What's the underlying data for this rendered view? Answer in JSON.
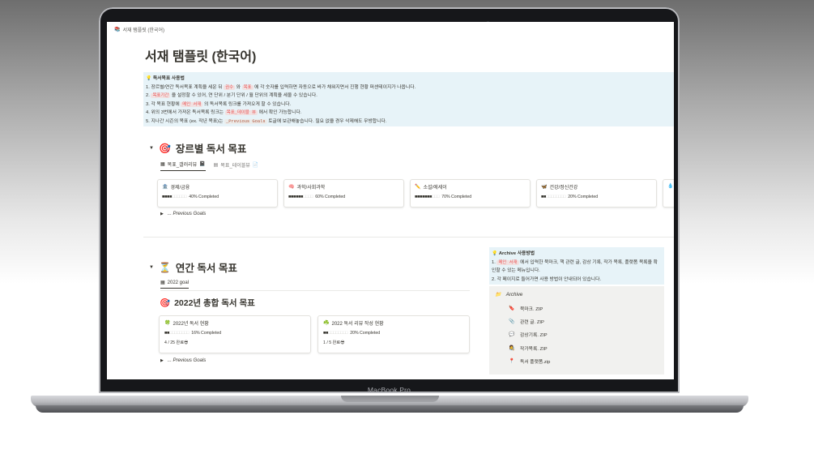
{
  "device": {
    "brand_label": "MacBook Pro"
  },
  "page": {
    "breadcrumb": "서재 탬플릿 (한국어)",
    "title": "서재 탬플릿 (한국어)"
  },
  "goal_callout": {
    "icon": "lightbulb-icon",
    "heading": "독서목표 사용법",
    "line1_a": "1. 장르별/연간 독서목표 계획을 세운 뒤 ",
    "line1_code1": "권수",
    "line1_b": " 와 ",
    "line1_code2": "목표",
    "line1_c": " 에 각 숫자를 입력하면 자동으로 바가 채워지면서 진행 현황 퍼센테이지가 나옵니다.",
    "line2_a": "2. ",
    "line2_code": "목표기간",
    "line2_b": " 을 설정할 수 있어, 연 단위 / 분기 단위 / 월 단위의 계획을 세울 수 있습니다.",
    "line3_a": "3. 각 목표 현황에 ",
    "line3_code": "메인 서재",
    "line3_b": " 의 독서목록 링크를 가져오게 할 수 있습니다.",
    "line4_a": "4. 위의 3번에서 가져온 독서목록 링크는 ",
    "line4_code": "목표_데이블 뷰",
    "line4_b": " 에서 확인 가능합니다.",
    "line5_a": "5. 지나간 시즌의 목표 (ex. 작년 목표)는 ",
    "line5_code": "_Previous Goals",
    "line5_b": " 토글에 보관해놓습니다. 필요 없을 경우 삭제해도 무방합니다."
  },
  "genre_section": {
    "title": "장르별 독서 목표",
    "tabs": [
      {
        "label": "목표_갤러리뷰"
      },
      {
        "label": "목표_테이블뷰"
      }
    ],
    "cards": [
      {
        "title": "경제/금융",
        "progress": 0.4,
        "progress_label": "40% Completed"
      },
      {
        "title": "과학/사회과학",
        "progress": 0.6,
        "progress_label": "60% Completed"
      },
      {
        "title": "소설/에세이",
        "progress": 0.7,
        "progress_label": "70% Completed"
      },
      {
        "title": "건강/정신건강",
        "progress": 0.2,
        "progress_label": "20% Completed"
      }
    ],
    "previous_goals": "... Previous Goals"
  },
  "annual_section": {
    "title": "연간 독서 목표",
    "tab": "2022 goal",
    "subtitle": "2022년 총합 독서 목표",
    "cards": [
      {
        "title": "2022년 독서 현황",
        "progress": 0.16,
        "progress_label": "16% Completed",
        "count": "4 / 25 완료"
      },
      {
        "title": "2022 독서 리뷰 작성 현황",
        "progress": 0.2,
        "progress_label": "20% Completed",
        "count": "1 / 5 완료"
      }
    ],
    "previous_goals": "... Previous Goals"
  },
  "archive_callout": {
    "heading": "Archive 사용방법",
    "line1_a": "1. ",
    "line1_code": "메인 서재",
    "line1_b": " 에서 입력한 북마크, 책 관련 글, 감상 기록, 작가 목록, 플랫폼 목록을 확인할 수 있는 메뉴입니다.",
    "line2": "2. 각 페이지로 들어가면 사용 방법이 안내되어 있습니다."
  },
  "archive_box": {
    "title": "Archive",
    "items": [
      {
        "label": "북마크. ZIP",
        "icon": "bookmark-icon"
      },
      {
        "label": "관련 글. ZIP",
        "icon": "paperclip-icon"
      },
      {
        "label": "감상기록. ZIP",
        "icon": "speech-bubble-icon"
      },
      {
        "label": "작가목록. ZIP",
        "icon": "writer-icon"
      },
      {
        "label": "독서 플랫폼.zip",
        "icon": "pin-icon"
      }
    ]
  }
}
